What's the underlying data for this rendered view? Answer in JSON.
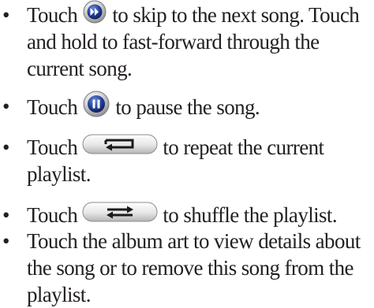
{
  "items": [
    {
      "lines": [
        {
          "before": "Touch",
          "icon": "skip-forward-icon",
          "after": "to skip to the next song. Touch"
        },
        {
          "text": "and hold to fast-forward through the"
        },
        {
          "text": "current song."
        }
      ]
    },
    {
      "lines": [
        {
          "before": "Touch",
          "icon": "pause-icon",
          "after": "to pause the song."
        }
      ]
    },
    {
      "lines": [
        {
          "before": "Touch",
          "icon": "repeat-icon",
          "after": "to repeat the current"
        },
        {
          "text": "playlist."
        }
      ]
    },
    {
      "lines": [
        {
          "before": "Touch",
          "icon": "shuffle-icon",
          "after": "to shuffle the playlist."
        }
      ]
    },
    {
      "lines": [
        {
          "text": "Touch the album art to view details about"
        },
        {
          "text": "the song or to remove this song from the"
        },
        {
          "text": "playlist."
        }
      ]
    }
  ],
  "bullet": "•"
}
